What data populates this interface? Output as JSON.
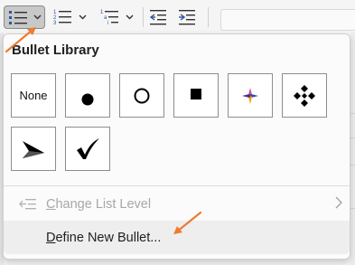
{
  "ribbon": {
    "buttons": [
      {
        "name": "bullets",
        "icon": "bulleted-list-icon",
        "state": "pressed"
      },
      {
        "name": "numbering",
        "icon": "numbered-list-icon"
      },
      {
        "name": "multilevel-list",
        "icon": "multilevel-list-icon"
      },
      {
        "name": "decrease-indent",
        "icon": "decrease-indent-icon"
      },
      {
        "name": "increase-indent",
        "icon": "increase-indent-icon"
      }
    ]
  },
  "panel": {
    "title": "Bullet Library",
    "none_label": "None",
    "bullets": [
      "none",
      "filled-circle",
      "hollow-circle",
      "filled-square",
      "four-diamond-star",
      "diamond-cluster",
      "arrowhead",
      "checkmark"
    ]
  },
  "menu": {
    "change_level": {
      "label_pre": "",
      "label_u": "C",
      "label_post": "hange List Level",
      "enabled": false
    },
    "define_new": {
      "label_pre": "",
      "label_u": "D",
      "label_post": "efine New Bullet..."
    }
  },
  "colors": {
    "accent_arrow": "#ee7b30",
    "pressed_bg": "#c8c8c8",
    "disabled_text": "#a7a7a7"
  }
}
